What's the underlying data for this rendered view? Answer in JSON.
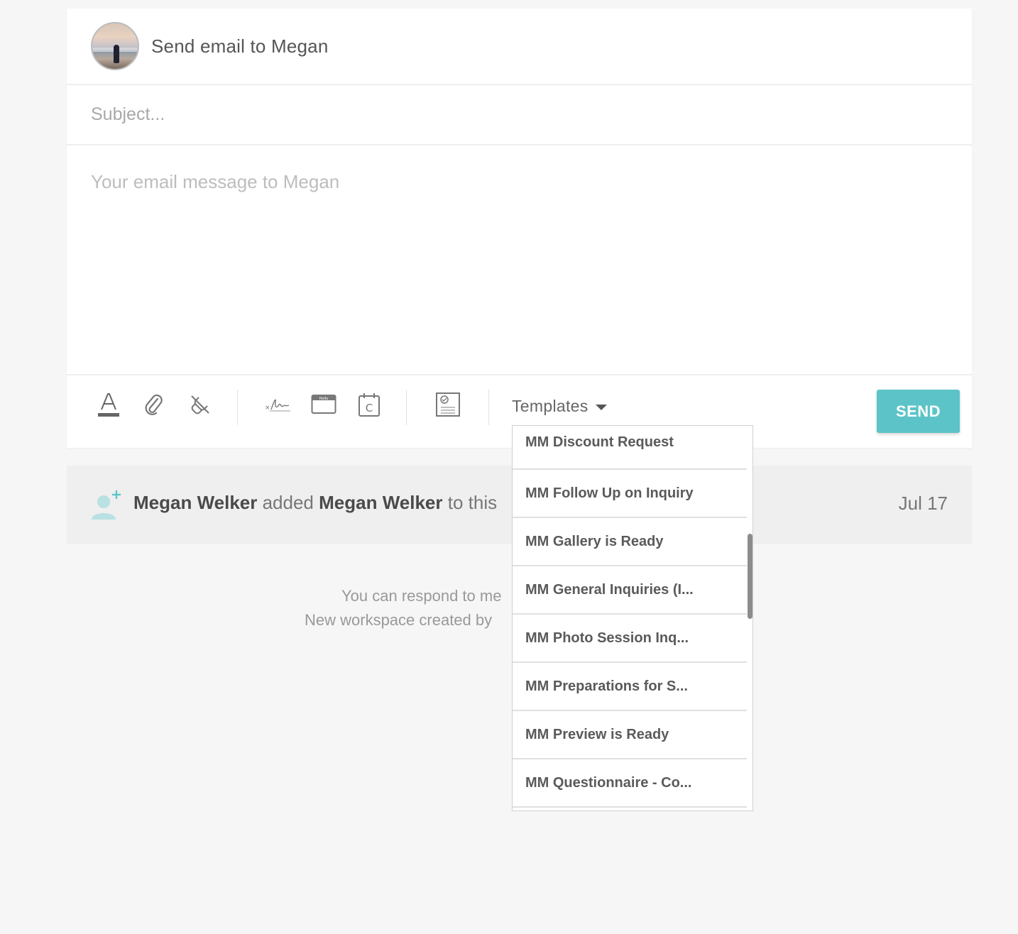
{
  "composer": {
    "title": "Send email to Megan",
    "subject_placeholder": "Subject...",
    "message_placeholder": "Your email message to Megan",
    "toolbar": {
      "icons": [
        "text-format-icon",
        "attachment-icon",
        "remove-link-icon",
        "signature-icon",
        "browser-window-icon",
        "calendar-icon",
        "certificate-icon"
      ],
      "templates_label": "Templates",
      "send_label": "SEND"
    }
  },
  "templates_dropdown": {
    "items": [
      "MM Discount Request",
      "MM Follow Up on Inquiry",
      "MM Gallery is Ready",
      "MM General Inquiries (I...",
      "MM Photo Session Inq...",
      "MM Preparations for S...",
      "MM Preview is Ready",
      "MM Questionnaire - Co..."
    ]
  },
  "activity": {
    "actor": "Megan Welker",
    "verb": "added",
    "target": "Megan Welker",
    "suffix": "to this",
    "date": "Jul 17"
  },
  "notes": {
    "line1": "You can respond to me",
    "line2": "New workspace created by"
  },
  "colors": {
    "accent": "#5cc4c8",
    "background": "#f6f6f6",
    "activity_background": "#efefef"
  }
}
